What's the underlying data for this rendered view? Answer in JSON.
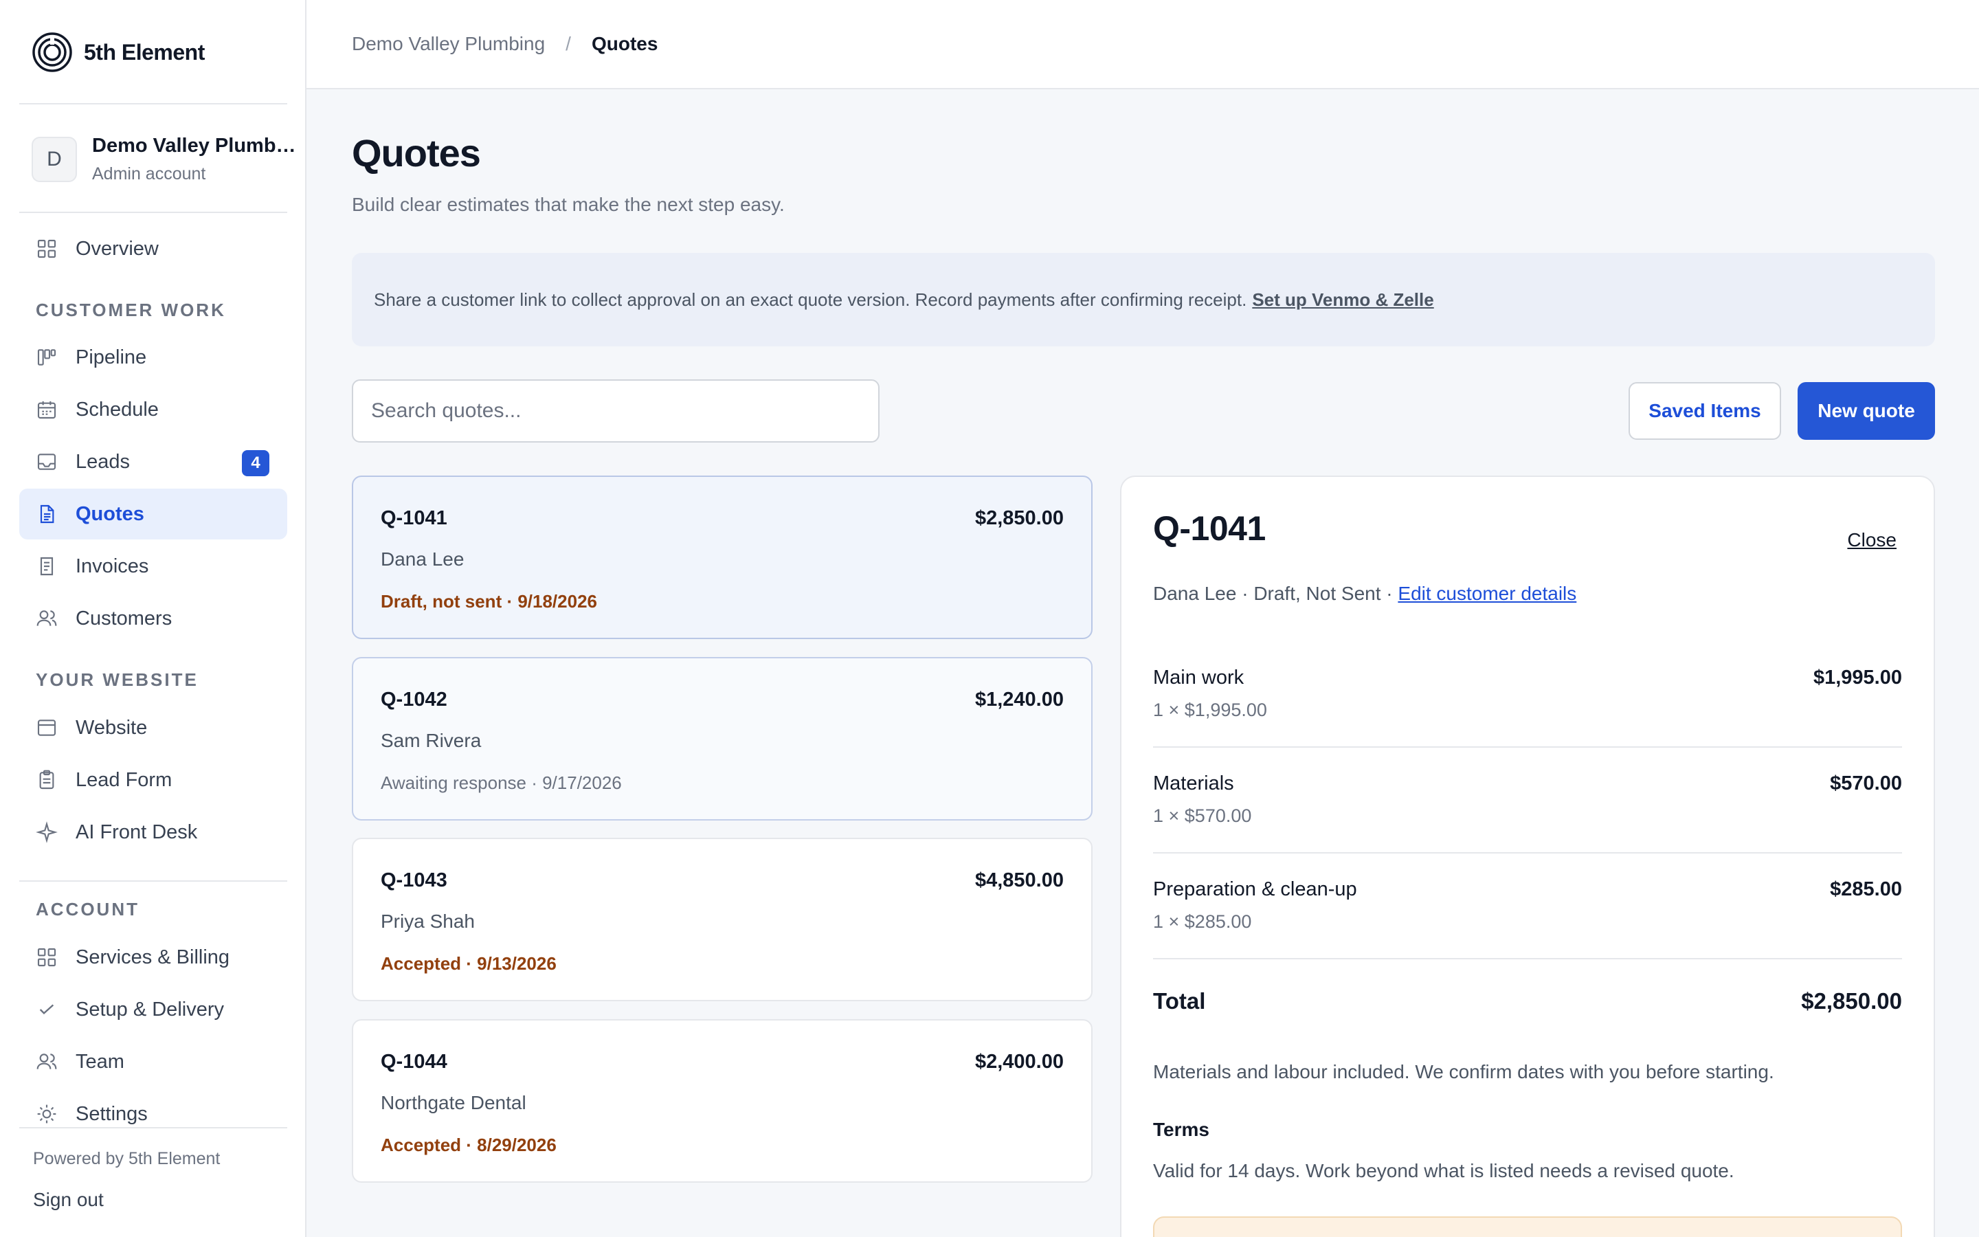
{
  "brand": {
    "name": "5th Element"
  },
  "account": {
    "initial": "D",
    "name": "Demo Valley Plumbing",
    "role": "Admin account"
  },
  "nav": {
    "overview": "Overview",
    "section_customer": "CUSTOMER WORK",
    "pipeline": "Pipeline",
    "schedule": "Schedule",
    "leads": "Leads",
    "leads_badge": "4",
    "quotes": "Quotes",
    "invoices": "Invoices",
    "customers": "Customers",
    "section_website": "YOUR WEBSITE",
    "website": "Website",
    "lead_form": "Lead Form",
    "ai_front_desk": "AI Front Desk",
    "section_account": "ACCOUNT",
    "services_billing": "Services & Billing",
    "setup_delivery": "Setup & Delivery",
    "team": "Team",
    "settings": "Settings"
  },
  "footer": {
    "powered": "Powered by 5th Element",
    "signout": "Sign out"
  },
  "breadcrumb": {
    "parent": "Demo Valley Plumbing",
    "separator": "/",
    "current": "Quotes"
  },
  "page": {
    "title": "Quotes",
    "subtitle": "Build clear estimates that make the next step easy.",
    "banner_text": "Share a customer link to collect approval on an exact quote version. Record payments after confirming receipt.",
    "banner_link": "Set up Venmo & Zelle"
  },
  "toolbar": {
    "search_placeholder": "Search quotes...",
    "saved_items": "Saved Items",
    "new_quote": "New quote"
  },
  "quotes": [
    {
      "id": "Q-1041",
      "amount": "$2,850.00",
      "customer": "Dana Lee",
      "status": "Draft, not sent · 9/18/2026"
    },
    {
      "id": "Q-1042",
      "amount": "$1,240.00",
      "customer": "Sam Rivera",
      "status": "Awaiting response · 9/17/2026"
    },
    {
      "id": "Q-1043",
      "amount": "$4,850.00",
      "customer": "Priya Shah",
      "status": "Accepted · 9/13/2026"
    },
    {
      "id": "Q-1044",
      "amount": "$2,400.00",
      "customer": "Northgate Dental",
      "status": "Accepted · 8/29/2026"
    }
  ],
  "detail": {
    "id": "Q-1041",
    "close": "Close",
    "meta": "Dana Lee · Draft, Not Sent ·",
    "edit_link": "Edit customer details",
    "lines": [
      {
        "name": "Main work",
        "qty": "1 × $1,995.00",
        "amount": "$1,995.00"
      },
      {
        "name": "Materials",
        "qty": "1 × $570.00",
        "amount": "$570.00"
      },
      {
        "name": "Preparation & clean-up",
        "qty": "1 × $285.00",
        "amount": "$285.00"
      }
    ],
    "total_label": "Total",
    "total_amount": "$2,850.00",
    "note": "Materials and labour included. We confirm dates with you before starting.",
    "terms_heading": "Terms",
    "terms_text": "Valid for 14 days. Work beyond what is listed needs a revised quote."
  },
  "colors": {
    "accent": "#2557d6",
    "active_bg": "#e8effd",
    "status_warm": "#92400e",
    "banner_bg": "#ebeff8"
  }
}
